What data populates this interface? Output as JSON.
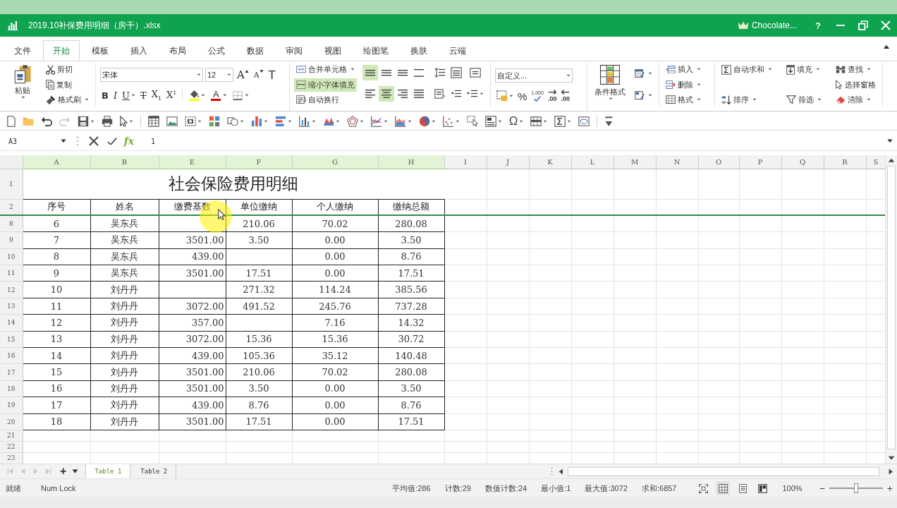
{
  "title_bar": {
    "title": "2019.10补保费用明细（房干）.xlsx",
    "user": "Chocolate...",
    "help": "?"
  },
  "menu": [
    {
      "label": "文件",
      "selected": false
    },
    {
      "label": "开始",
      "selected": true
    },
    {
      "label": "模板",
      "selected": false
    },
    {
      "label": "插入",
      "selected": false
    },
    {
      "label": "布局",
      "selected": false
    },
    {
      "label": "公式",
      "selected": false
    },
    {
      "label": "数据",
      "selected": false
    },
    {
      "label": "审阅",
      "selected": false
    },
    {
      "label": "视图",
      "selected": false
    },
    {
      "label": "绘图笔",
      "selected": false
    },
    {
      "label": "换肤",
      "selected": false
    },
    {
      "label": "云端",
      "selected": false
    }
  ],
  "ribbon": {
    "clipboard": {
      "paste": "粘贴",
      "items": [
        {
          "label": "剪切",
          "dropdown": false
        },
        {
          "label": "复制",
          "dropdown": false
        },
        {
          "label": "格式刷",
          "dropdown": true
        }
      ]
    },
    "font": {
      "family": "宋体",
      "size": "12",
      "size_buttons": [
        {
          "kind": "grow",
          "label": "A"
        },
        {
          "kind": "shrink",
          "label": "A"
        },
        {
          "kind": "clear",
          "label": "T"
        }
      ],
      "format_buttons": [
        {
          "label": "B",
          "dropdown": false
        },
        {
          "label": "I",
          "dropdown": false
        },
        {
          "label": "U",
          "dropdown": true
        },
        {
          "label": "T",
          "dropdown": false
        },
        {
          "label": "X$_{1}$",
          "dropdown": false
        },
        {
          "label": "X$^{1}$",
          "dropdown": false
        }
      ],
      "color_buttons": [
        {
          "kind": "fill",
          "color": "#ffff00",
          "dropdown": true
        },
        {
          "kind": "font-color",
          "label": "A",
          "color": "#e00000",
          "dropdown": true
        },
        {
          "kind": "borders",
          "dropdown": true
        }
      ]
    },
    "alignment": {
      "merge_buttons": [
        {
          "label": "合并单元格",
          "dropdown": true,
          "selected": false
        },
        {
          "label": "缩小字体填充",
          "dropdown": false,
          "selected": true
        },
        {
          "label": "自动换行",
          "dropdown": false,
          "selected": false
        }
      ],
      "align_buttons": [
        {
          "selected": true
        },
        {
          "selected": false
        },
        {
          "selected": false
        },
        {
          "selected": false
        },
        {
          "selected": false
        },
        {
          "selected": true
        },
        {
          "selected": false
        },
        {
          "selected": false
        }
      ],
      "extra_buttons": [
        {
          "dropdown": false
        },
        {
          "dropdown": false
        },
        {
          "dropdown": false
        },
        {
          "dropdown": false
        },
        {
          "dropdown": false
        },
        {
          "dropdown": true
        }
      ]
    },
    "number": {
      "format": "自定义...",
      "buttons": [
        {
          "kind": "currency",
          "dropdown": true
        },
        {
          "kind": "percent",
          "label": "%",
          "dropdown": false
        },
        {
          "kind": "thousands",
          "label": "1,000",
          "dropdown": false
        },
        {
          "kind": "increase-decimal",
          "label": ".00",
          "dropdown": false
        },
        {
          "kind": "decrease-decimal",
          "label": ".00",
          "dropdown": false
        }
      ]
    },
    "styles": {
      "conditional": "条件格式",
      "buttons": [
        {
          "dropdown": true
        },
        {
          "dropdown": true
        }
      ]
    },
    "cells": [
      {
        "label": "插入",
        "dropdown": true
      },
      {
        "label": "删除",
        "dropdown": true
      },
      {
        "label": "格式",
        "dropdown": true
      }
    ],
    "editing": [
      [
        {
          "label": "自动求和",
          "dropdown": true
        },
        {
          "label": "排序",
          "dropdown": true
        }
      ],
      [
        {
          "label": "填充",
          "dropdown": true
        },
        {
          "label": "筛选",
          "dropdown": true
        }
      ],
      [
        {
          "label": "查找",
          "dropdown": true
        },
        {
          "label": "选择窗格",
          "dropdown": false
        },
        {
          "label": "清除",
          "dropdown": true
        }
      ]
    ]
  },
  "quick_toolbar": [
    {
      "kind": "button",
      "dropdown": false,
      "disabled": false
    },
    {
      "kind": "button",
      "dropdown": false,
      "disabled": false
    },
    {
      "kind": "button",
      "dropdown": false,
      "disabled": false
    },
    {
      "kind": "button",
      "dropdown": false,
      "disabled": true
    },
    {
      "kind": "button",
      "dropdown": true,
      "disabled": false
    },
    {
      "kind": "button",
      "dropdown": false,
      "disabled": false
    },
    {
      "kind": "button",
      "dropdown": true,
      "disabled": false
    },
    {
      "kind": "separator"
    },
    {
      "kind": "button",
      "dropdown": false,
      "disabled": false
    },
    {
      "kind": "button",
      "dropdown": false,
      "disabled": false
    },
    {
      "kind": "button",
      "dropdown": true,
      "disabled": false
    },
    {
      "kind": "button",
      "dropdown": false,
      "disabled": false
    },
    {
      "kind": "button",
      "dropdown": true,
      "disabled": false
    },
    {
      "kind": "button",
      "dropdown": true,
      "disabled": false
    },
    {
      "kind": "button",
      "dropdown": true,
      "disabled": false
    },
    {
      "kind": "button",
      "dropdown": true,
      "disabled": false
    },
    {
      "kind": "button",
      "dropdown": true,
      "disabled": false
    },
    {
      "kind": "button",
      "dropdown": true,
      "disabled": false
    },
    {
      "kind": "button",
      "dropdown": true,
      "disabled": false
    },
    {
      "kind": "button",
      "dropdown": true,
      "disabled": false
    },
    {
      "kind": "button",
      "dropdown": true,
      "disabled": false
    },
    {
      "kind": "button",
      "dropdown": true,
      "disabled": false
    },
    {
      "kind": "button",
      "dropdown": false,
      "disabled": false
    },
    {
      "kind": "button",
      "dropdown": true,
      "disabled": false
    },
    {
      "kind": "symbol",
      "label": "Ω",
      "dropdown": true,
      "disabled": false
    },
    {
      "kind": "button",
      "dropdown": true,
      "disabled": false
    },
    {
      "kind": "button",
      "dropdown": true,
      "disabled": false
    },
    {
      "kind": "button",
      "dropdown": false,
      "disabled": false
    },
    {
      "kind": "separator"
    },
    {
      "kind": "button",
      "dropdown": false,
      "disabled": false
    }
  ],
  "formula_bar": {
    "cell": "A3",
    "function_label": "fx",
    "value": "1"
  },
  "sheet": {
    "columns": [
      {
        "label": "A",
        "highlighted": true
      },
      {
        "label": "B",
        "highlighted": true
      },
      {
        "label": "E",
        "highlighted": true
      },
      {
        "label": "F",
        "highlighted": true
      },
      {
        "label": "G",
        "highlighted": true
      },
      {
        "label": "H",
        "highlighted": true
      },
      {
        "label": "I",
        "highlighted": false
      },
      {
        "label": "J",
        "highlighted": false
      },
      {
        "label": "K",
        "highlighted": false
      },
      {
        "label": "L",
        "highlighted": false
      },
      {
        "label": "M",
        "highlighted": false
      },
      {
        "label": "N",
        "highlighted": false
      },
      {
        "label": "O",
        "highlighted": false
      },
      {
        "label": "P",
        "highlighted": false
      },
      {
        "label": "Q",
        "highlighted": false
      },
      {
        "label": "R",
        "highlighted": false
      },
      {
        "label": "S",
        "highlighted": false
      }
    ],
    "title_row": {
      "header": "1",
      "title": "社会保险费用明细"
    },
    "header_row": {
      "header": "2",
      "cells": [
        "序号",
        "姓名",
        "缴费基数",
        "单位缴纳",
        "个人缴纳",
        "缴纳总额"
      ]
    },
    "rows": [
      {
        "header": "8",
        "cells": [
          "6",
          "吴东兵",
          null,
          "210.06",
          "70.02",
          "280.08"
        ]
      },
      {
        "header": "9",
        "cells": [
          "7",
          "吴东兵",
          "3501.00",
          "3.50",
          "0.00",
          "3.50"
        ]
      },
      {
        "header": "10",
        "cells": [
          "8",
          "吴东兵",
          "439.00",
          null,
          "0.00",
          "8.76"
        ]
      },
      {
        "header": "11",
        "cells": [
          "9",
          "吴东兵",
          "3501.00",
          "17.51",
          "0.00",
          "17.51"
        ]
      },
      {
        "header": "12",
        "cells": [
          "10",
          "刘丹丹",
          null,
          "271.32",
          "114.24",
          "385.56"
        ]
      },
      {
        "header": "13",
        "cells": [
          "11",
          "刘丹丹",
          "3072.00",
          "491.52",
          "245.76",
          "737.28"
        ]
      },
      {
        "header": "14",
        "cells": [
          "12",
          "刘丹丹",
          "357.00",
          null,
          "7.16",
          "14.32"
        ]
      },
      {
        "header": "15",
        "cells": [
          "13",
          "刘丹丹",
          "3072.00",
          "15.36",
          "15.36",
          "30.72"
        ]
      },
      {
        "header": "16",
        "cells": [
          "14",
          "刘丹丹",
          "439.00",
          "105.36",
          "35.12",
          "140.48"
        ]
      },
      {
        "header": "17",
        "cells": [
          "15",
          "刘丹丹",
          "3501.00",
          "210.06",
          "70.02",
          "280.08"
        ]
      },
      {
        "header": "18",
        "cells": [
          "16",
          "刘丹丹",
          "3501.00",
          "3.50",
          "0.00",
          "3.50"
        ]
      },
      {
        "header": "19",
        "cells": [
          "17",
          "刘丹丹",
          "439.00",
          "8.76",
          "0.00",
          "8.76"
        ]
      },
      {
        "header": "20",
        "cells": [
          "18",
          "刘丹丹",
          "3501.00",
          "17.51",
          "0.00",
          "17.51"
        ]
      }
    ],
    "empty_rows": [
      "21",
      "22",
      "23"
    ],
    "frozen": true
  },
  "pointer": {
    "highlight": true
  },
  "sheet_tabs": {
    "add": "+",
    "tabs": [
      {
        "label": "Table 1",
        "selected": true
      },
      {
        "label": "Table 2",
        "selected": false
      }
    ]
  },
  "status_bar": {
    "mode": "就绪",
    "num_lock": "Num Lock",
    "stats": [
      "平均值:286",
      "计数:29",
      "数值计数:24",
      "最小值:1",
      "最大值:3072",
      "求和:6857"
    ],
    "views": [
      {
        "selected": false
      },
      {
        "selected": true
      },
      {
        "selected": false
      },
      {
        "selected": false
      }
    ],
    "zoom": "100%",
    "zoom_out": "−",
    "zoom_in": "+",
    "zoom_slider": {
      "level": 0.5
    }
  }
}
